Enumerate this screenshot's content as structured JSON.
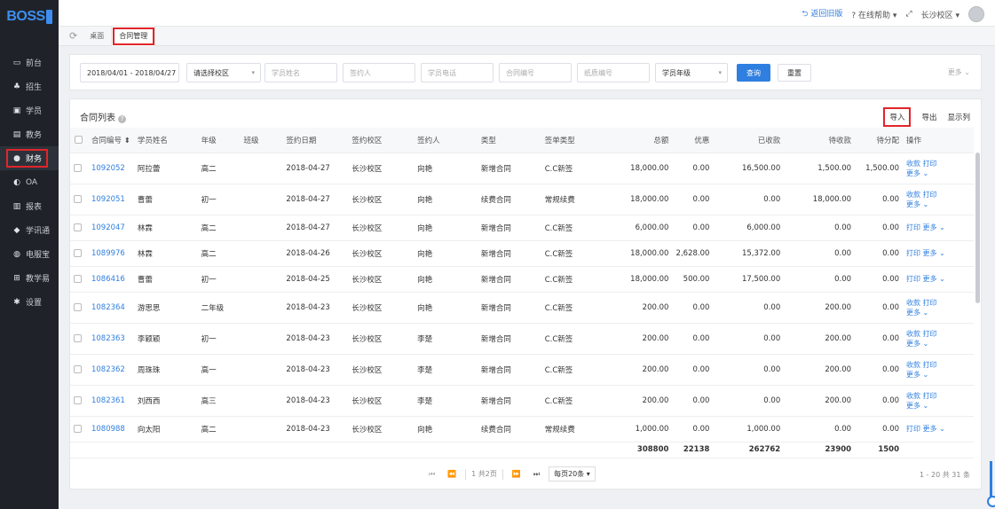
{
  "app": {
    "logo": "BOSS"
  },
  "sidebar": {
    "items": [
      {
        "label": "前台",
        "icon": "monitor-icon"
      },
      {
        "label": "招生",
        "icon": "users-icon"
      },
      {
        "label": "学员",
        "icon": "id-card-icon"
      },
      {
        "label": "教务",
        "icon": "book-icon"
      },
      {
        "label": "财务",
        "icon": "finance-icon",
        "active": true
      },
      {
        "label": "OA",
        "icon": "toggle-icon"
      },
      {
        "label": "报表",
        "icon": "bar-chart-icon"
      },
      {
        "label": "学讯通",
        "icon": "location-icon"
      },
      {
        "label": "电服宝",
        "icon": "phone-icon"
      },
      {
        "label": "教学易",
        "icon": "teach-icon"
      },
      {
        "label": "设置",
        "icon": "gear-icon"
      }
    ]
  },
  "topbar": {
    "back": "返回旧版",
    "help": "在线帮助",
    "campus": "长沙校区"
  },
  "tabs": {
    "home": "桌面",
    "contract": "合同管理"
  },
  "filters": {
    "date_range": "2018/04/01 - 2018/04/27",
    "campus": "请选择校区",
    "student_name": "学员姓名",
    "signer": "签约人",
    "phone": "学员电话",
    "contract_no": "合同编号",
    "paper_no": "纸质编号",
    "grade": "学员年级",
    "search": "查询",
    "reset": "重置",
    "more": "更多"
  },
  "panel": {
    "title": "合同列表",
    "import": "导入",
    "export": "导出",
    "columns": "显示列"
  },
  "table": {
    "headers": [
      "合同编号",
      "学员姓名",
      "年级",
      "班级",
      "签约日期",
      "签约校区",
      "签约人",
      "类型",
      "签单类型",
      "总额",
      "优惠",
      "已收款",
      "待收款",
      "待分配",
      "操作"
    ],
    "rows": [
      {
        "id": "1092052",
        "name": "阿拉蕾",
        "grade": "高二",
        "class": "",
        "date": "2018-04-27",
        "campus": "长沙校区",
        "signer": "向艳",
        "type": "新增合同",
        "sign_type": "C.C新签",
        "total": "18,000.00",
        "discount": "0.00",
        "paid": "16,500.00",
        "due": "1,500.00",
        "alloc": "1,500.00",
        "ops1": "收款 打印",
        "ops2": "更多 ⌄",
        "tall": true
      },
      {
        "id": "1092051",
        "name": "曹蕾",
        "grade": "初一",
        "class": "",
        "date": "2018-04-27",
        "campus": "长沙校区",
        "signer": "向艳",
        "type": "续费合同",
        "sign_type": "常规续费",
        "total": "18,000.00",
        "discount": "0.00",
        "paid": "0.00",
        "due": "18,000.00",
        "alloc": "0.00",
        "ops1": "收款 打印",
        "ops2": "更多 ⌄",
        "tall": true
      },
      {
        "id": "1092047",
        "name": "林霖",
        "grade": "高二",
        "class": "",
        "date": "2018-04-27",
        "campus": "长沙校区",
        "signer": "向艳",
        "type": "新增合同",
        "sign_type": "C.C新签",
        "total": "6,000.00",
        "discount": "0.00",
        "paid": "6,000.00",
        "due": "0.00",
        "alloc": "0.00",
        "ops1": "打印 更多 ⌄",
        "ops2": "",
        "tall": false
      },
      {
        "id": "1089976",
        "name": "林霖",
        "grade": "高二",
        "class": "",
        "date": "2018-04-26",
        "campus": "长沙校区",
        "signer": "向艳",
        "type": "新增合同",
        "sign_type": "C.C新签",
        "total": "18,000.00",
        "discount": "2,628.00",
        "paid": "15,372.00",
        "due": "0.00",
        "alloc": "0.00",
        "ops1": "打印 更多 ⌄",
        "ops2": "",
        "tall": false
      },
      {
        "id": "1086416",
        "name": "曹蕾",
        "grade": "初一",
        "class": "",
        "date": "2018-04-25",
        "campus": "长沙校区",
        "signer": "向艳",
        "type": "新增合同",
        "sign_type": "C.C新签",
        "total": "18,000.00",
        "discount": "500.00",
        "paid": "17,500.00",
        "due": "0.00",
        "alloc": "0.00",
        "ops1": "打印 更多 ⌄",
        "ops2": "",
        "tall": false
      },
      {
        "id": "1082364",
        "name": "游思思",
        "grade": "二年级",
        "class": "",
        "date": "2018-04-23",
        "campus": "长沙校区",
        "signer": "向艳",
        "type": "新增合同",
        "sign_type": "C.C新签",
        "total": "200.00",
        "discount": "0.00",
        "paid": "0.00",
        "due": "200.00",
        "alloc": "0.00",
        "ops1": "收款 打印",
        "ops2": "更多 ⌄",
        "tall": true
      },
      {
        "id": "1082363",
        "name": "李颖颖",
        "grade": "初一",
        "class": "",
        "date": "2018-04-23",
        "campus": "长沙校区",
        "signer": "李楚",
        "type": "新增合同",
        "sign_type": "C.C新签",
        "total": "200.00",
        "discount": "0.00",
        "paid": "0.00",
        "due": "200.00",
        "alloc": "0.00",
        "ops1": "收款 打印",
        "ops2": "更多 ⌄",
        "tall": true
      },
      {
        "id": "1082362",
        "name": "周珠珠",
        "grade": "高一",
        "class": "",
        "date": "2018-04-23",
        "campus": "长沙校区",
        "signer": "李楚",
        "type": "新增合同",
        "sign_type": "C.C新签",
        "total": "200.00",
        "discount": "0.00",
        "paid": "0.00",
        "due": "200.00",
        "alloc": "0.00",
        "ops1": "收款 打印",
        "ops2": "更多 ⌄",
        "tall": true
      },
      {
        "id": "1082361",
        "name": "刘西西",
        "grade": "高三",
        "class": "",
        "date": "2018-04-23",
        "campus": "长沙校区",
        "signer": "李楚",
        "type": "新增合同",
        "sign_type": "C.C新签",
        "total": "200.00",
        "discount": "0.00",
        "paid": "0.00",
        "due": "200.00",
        "alloc": "0.00",
        "ops1": "收款 打印",
        "ops2": "更多 ⌄",
        "tall": true
      },
      {
        "id": "1080988",
        "name": "向太阳",
        "grade": "高二",
        "class": "",
        "date": "2018-04-23",
        "campus": "长沙校区",
        "signer": "向艳",
        "type": "续费合同",
        "sign_type": "常规续费",
        "total": "1,000.00",
        "discount": "0.00",
        "paid": "1,000.00",
        "due": "0.00",
        "alloc": "0.00",
        "ops1": "打印 更多 ⌄",
        "ops2": "",
        "tall": false
      }
    ],
    "totals": {
      "total": "308800",
      "discount": "22138",
      "paid": "262762",
      "due": "23900",
      "alloc": "1500"
    }
  },
  "pager": {
    "page_info": "1 共2页",
    "page_size": "每页20条",
    "range": "1 - 20 共 31 条"
  }
}
